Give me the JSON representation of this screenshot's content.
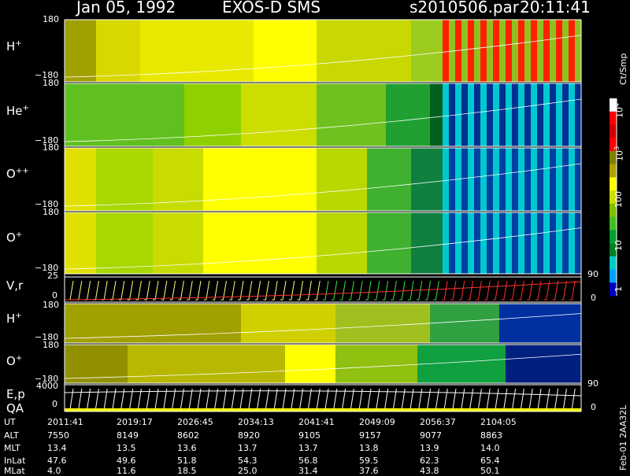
{
  "header": {
    "date": "Jan 05, 1992",
    "instrument": "EXOS-D SMS",
    "file": "s2010506.par",
    "time": "20:11:41"
  },
  "colorbar": {
    "unit": "Ct/Smp",
    "labels": [
      "10",
      "10",
      "100",
      "10",
      "1"
    ],
    "exponents": [
      "4",
      "3"
    ],
    "colors": [
      "#ffffff",
      "#ff0000",
      "#cc0000",
      "#ff0000",
      "#808000",
      "#b0a000",
      "#ffff00",
      "#ccdd00",
      "#80c000",
      "#40c020",
      "#00a030",
      "#008020",
      "#00c8c8",
      "#00a0ff",
      "#0000c0"
    ]
  },
  "panels": [
    {
      "label": "H",
      "sup": "+",
      "ymax": "180",
      "ymin": "−180"
    },
    {
      "label": "He",
      "sup": "+",
      "ymax": "180",
      "ymin": "−180"
    },
    {
      "label": "O",
      "sup": "++",
      "ymax": "180",
      "ymin": "−180"
    },
    {
      "label": "O",
      "sup": "+",
      "ymax": "180",
      "ymin": "−180"
    },
    {
      "label": "V,r",
      "sup": "",
      "ymax": "25",
      "ymin": "0"
    },
    {
      "label": "H",
      "sup": "+",
      "ymax": "180",
      "ymin": "−180"
    },
    {
      "label": "O",
      "sup": "+",
      "ymax": "180",
      "ymin": "−180"
    },
    {
      "label": "E,p",
      "sup": "",
      "ymax": "4000",
      "ymin": "0"
    }
  ],
  "qa_label": "QA",
  "right_axis": {
    "v_top": "90",
    "v_bot": "0",
    "e_top": "90",
    "e_bot": "0"
  },
  "orbit_table": {
    "rows": [
      {
        "label": "UT",
        "values": [
          "2011:41",
          "2019:17",
          "2026:45",
          "2034:13",
          "2041:41",
          "2049:09",
          "2056:37",
          "2104:05"
        ]
      },
      {
        "label": "ALT",
        "values": [
          "7550",
          "8149",
          "8602",
          "8920",
          "9105",
          "9157",
          "9077",
          "8863"
        ]
      },
      {
        "label": "MLT",
        "values": [
          "13.4",
          "13.5",
          "13.6",
          "13.7",
          "13.7",
          "13.8",
          "13.9",
          "14.0"
        ]
      },
      {
        "label": "InLat",
        "values": [
          "47.6",
          "49.6",
          "51.8",
          "54.3",
          "56.8",
          "59.5",
          "62.3",
          "65.4"
        ]
      },
      {
        "label": "MLat",
        "values": [
          "4.0",
          "11.6",
          "18.5",
          "25.0",
          "31.4",
          "37.6",
          "43.8",
          "50.1"
        ]
      }
    ]
  },
  "footer_code": "Feb-01 2AA32L",
  "chart_data": {
    "type": "heatmap",
    "title": "Jan 05, 1992   EXOS-D SMS",
    "x_label": "UT",
    "x": [
      "2011:41",
      "2019:17",
      "2026:45",
      "2034:13",
      "2041:41",
      "2049:09",
      "2056:37",
      "2104:05"
    ],
    "colorbar_unit": "Ct/Smp",
    "colorbar_scale": "log",
    "colorbar_range": [
      1,
      10000
    ],
    "series": [
      {
        "name": "H+",
        "ylim": [
          -180,
          180
        ]
      },
      {
        "name": "He+",
        "ylim": [
          -180,
          180
        ]
      },
      {
        "name": "O++",
        "ylim": [
          -180,
          180
        ]
      },
      {
        "name": "O+",
        "ylim": [
          -180,
          180
        ]
      },
      {
        "name": "V,r",
        "ylim": [
          0,
          25
        ]
      },
      {
        "name": "H+",
        "ylim": [
          -180,
          180
        ]
      },
      {
        "name": "O+",
        "ylim": [
          -180,
          180
        ]
      },
      {
        "name": "E,p",
        "ylim": [
          0,
          4000
        ]
      }
    ]
  }
}
